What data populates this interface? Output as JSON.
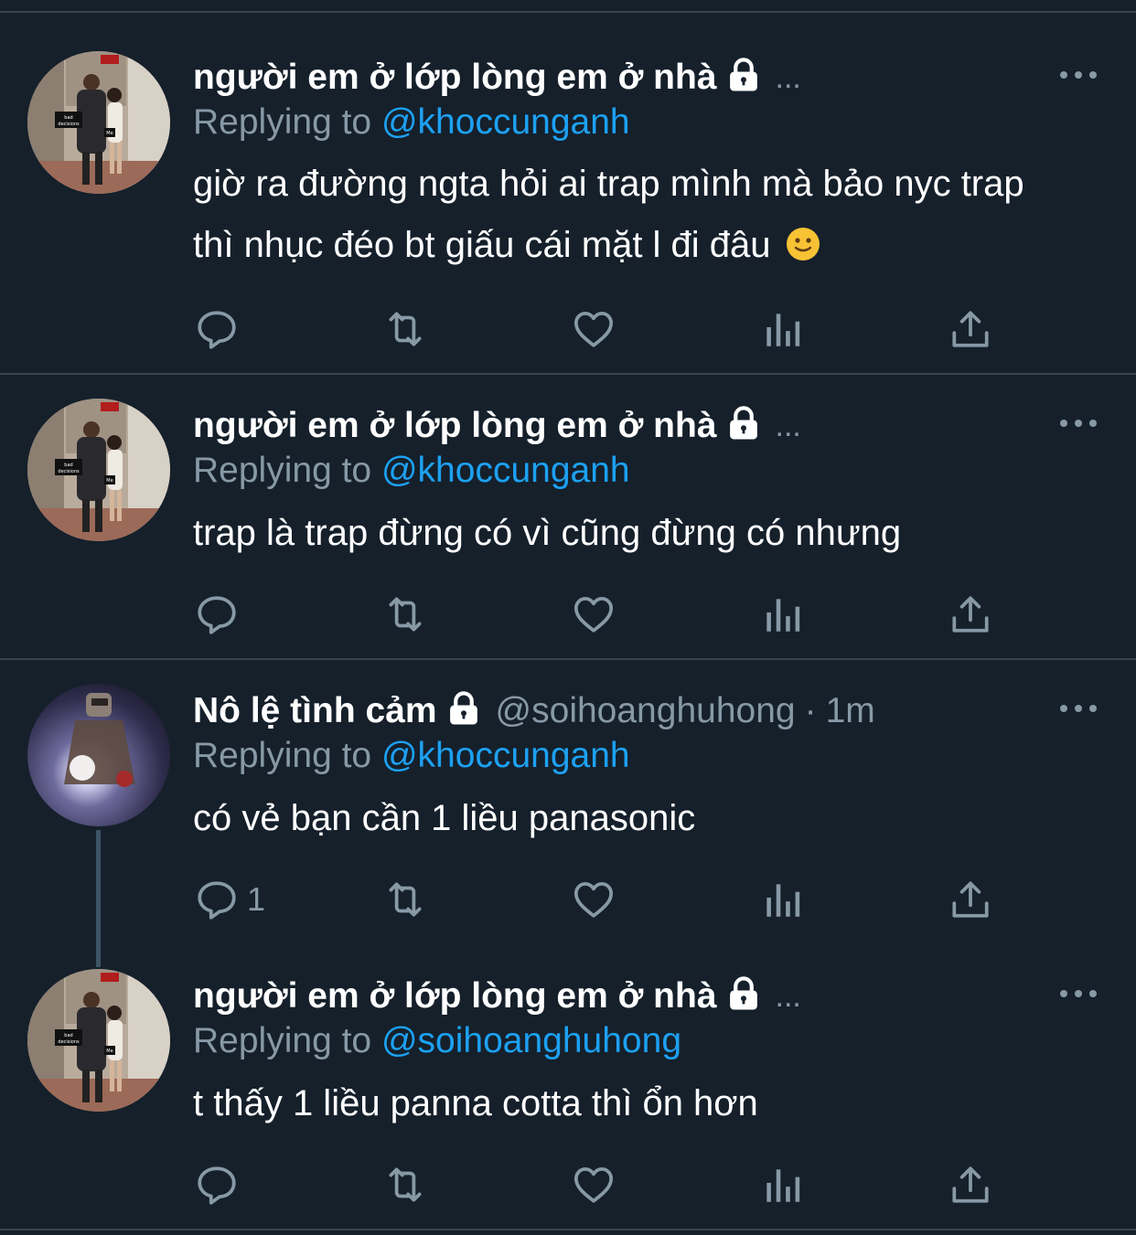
{
  "colors": {
    "background": "#15202b",
    "divider": "#38444d",
    "secondary_text": "#8899a6",
    "link": "#1da1f2",
    "icon": "#8899a6"
  },
  "tweets": [
    {
      "display_name": "người em ở lớp lòng em ở nhà",
      "locked_icon": "lock-icon",
      "handle_truncated": "...",
      "replying_prefix": "Replying to",
      "replying_to": "@khoccunganh",
      "text": "giờ ra đường ngta hỏi ai trap mình mà bảo nyc trap thì nhục đéo bt giấu cái mặt l đi đâu",
      "emoji": "slightly-smiling-face",
      "reply_count": ""
    },
    {
      "display_name": "người em ở lớp lòng em ở nhà",
      "locked_icon": "lock-icon",
      "handle_truncated": "...",
      "replying_prefix": "Replying to",
      "replying_to": "@khoccunganh",
      "text": "trap là trap đừng có vì cũng đừng có nhưng",
      "reply_count": ""
    },
    {
      "display_name": "Nô lệ tình cảm",
      "locked_icon": "lock-icon",
      "handle": "@soihoanghuhong",
      "separator": "·",
      "time": "1m",
      "replying_prefix": "Replying to",
      "replying_to": "@khoccunganh",
      "text": "có vẻ bạn cần 1 liều panasonic",
      "reply_count": "1"
    },
    {
      "display_name": "người em ở lớp lòng em ở nhà",
      "locked_icon": "lock-icon",
      "handle_truncated": "...",
      "replying_prefix": "Replying to",
      "replying_to": "@soihoanghuhong",
      "text": "t thấy 1 liều panna cotta thì ổn hơn",
      "reply_count": ""
    }
  ],
  "action_icons": [
    "reply-icon",
    "retweet-icon",
    "like-icon",
    "analytics-icon",
    "share-icon"
  ]
}
